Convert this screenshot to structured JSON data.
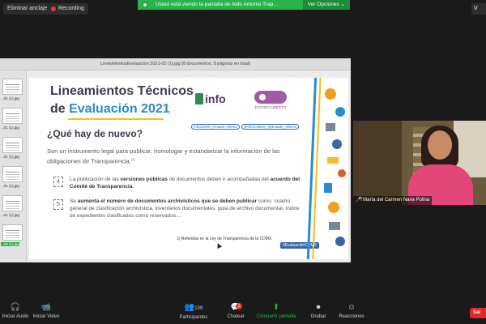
{
  "top": {
    "unpin_label": "Eliminar anclaje",
    "recording_label": "Recording",
    "view_label": "V"
  },
  "banner": {
    "text": "Usted está viendo la pantalla de Aldo Antonio Trap…",
    "options_label": "Ver Opciones ⌄"
  },
  "window_title": "LineamientosEvaluacion 2021-02 (1).jpg (8 documentos, 8 páginas en total)",
  "thumbnails": [
    "...01 (1).jpg",
    "...01 (1).jpg",
    "...01 (1).jpg",
    "...01 (1).jpg",
    "...01 (1).jpg",
    "...02 (1).jpg"
  ],
  "slide": {
    "title_line1": "Lineamientos Técnicos",
    "title_de": "de",
    "title_line2": "Evaluación 2021",
    "logo_info": "info",
    "logo_eg": "ESTADO ABIERTO",
    "socials": [
      "InfoCDMX | Estado.Abierto",
      "@InfoCdMex | @Estado_Abierto"
    ],
    "question": "¿Qué hay de nuevo?",
    "intro": "Son un instrumento legal para publicar, homologar y estandarizar la información de las obligaciones de Transparencia.",
    "intro_sup": "(1)",
    "b1_pre": "La publicación de las ",
    "b1_bold1": "versiones públicas",
    "b1_mid": " de documentos deben ir acompañadas del ",
    "b1_bold2": "acuerdo del Comité de Transparencia.",
    "b2_pre": "Se ",
    "b2_bold": "aumenta el número de documentos archivísticos que se deben publicar",
    "b2_post": " como: cuadro general de clasificación archivística, inventarios documentales, guía de archivo documental, índice de expedientes clasificados como reservados…",
    "footnote": "1) Referidas en la Ley de Transparencia de la CDMX.",
    "hashtag": "#EvaluaciónCDMX"
  },
  "video": {
    "participant_name": "María del Carmen Nava Polina"
  },
  "toolbar": {
    "audio": "Iniciar Audio",
    "video": "Iniciar Video",
    "participants": "Participantes",
    "participants_count": "139",
    "chat": "Chatear",
    "chat_badge": "1",
    "share": "Compartir pantalla",
    "record": "Grabar",
    "reactions": "Reacciones",
    "leave": "Sal"
  },
  "colors": {
    "accent_green": "#29b34a",
    "title_blue": "#2a8bd0",
    "leave_red": "#e02828"
  }
}
